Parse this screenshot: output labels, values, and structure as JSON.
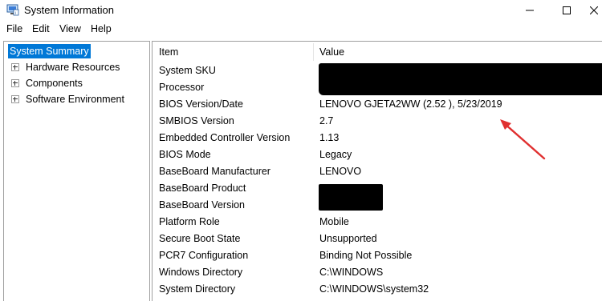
{
  "window": {
    "title": "System Information",
    "icon": "system-information-app-icon",
    "controls": [
      "minimize-icon",
      "maximize-icon",
      "close-icon"
    ]
  },
  "menubar": [
    "File",
    "Edit",
    "View",
    "Help"
  ],
  "tree": [
    {
      "label": "System Summary",
      "selected": true,
      "expandable": false
    },
    {
      "label": "Hardware Resources",
      "selected": false,
      "expandable": true
    },
    {
      "label": "Components",
      "selected": false,
      "expandable": true
    },
    {
      "label": "Software Environment",
      "selected": false,
      "expandable": true
    }
  ],
  "table": {
    "columns": [
      "Item",
      "Value"
    ],
    "rows": [
      {
        "item": "System SKU",
        "value": "",
        "redacted": true
      },
      {
        "item": "Processor",
        "value": "",
        "redacted": true
      },
      {
        "item": "BIOS Version/Date",
        "value": "LENOVO GJETA2WW (2.52 ), 5/23/2019"
      },
      {
        "item": "SMBIOS Version",
        "value": "2.7"
      },
      {
        "item": "Embedded Controller Version",
        "value": "1.13"
      },
      {
        "item": "BIOS Mode",
        "value": "Legacy"
      },
      {
        "item": "BaseBoard Manufacturer",
        "value": "LENOVO"
      },
      {
        "item": "BaseBoard Product",
        "value": "",
        "redacted": true
      },
      {
        "item": "BaseBoard Version",
        "value": "",
        "redacted": true
      },
      {
        "item": "Platform Role",
        "value": "Mobile"
      },
      {
        "item": "Secure Boot State",
        "value": "Unsupported"
      },
      {
        "item": "PCR7 Configuration",
        "value": "Binding Not Possible"
      },
      {
        "item": "Windows Directory",
        "value": "C:\\WINDOWS"
      },
      {
        "item": "System Directory",
        "value": "C:\\WINDOWS\\system32"
      }
    ]
  },
  "colors": {
    "selection": "#0078d7",
    "annotation_arrow": "#e03030",
    "redaction": "#000000"
  }
}
